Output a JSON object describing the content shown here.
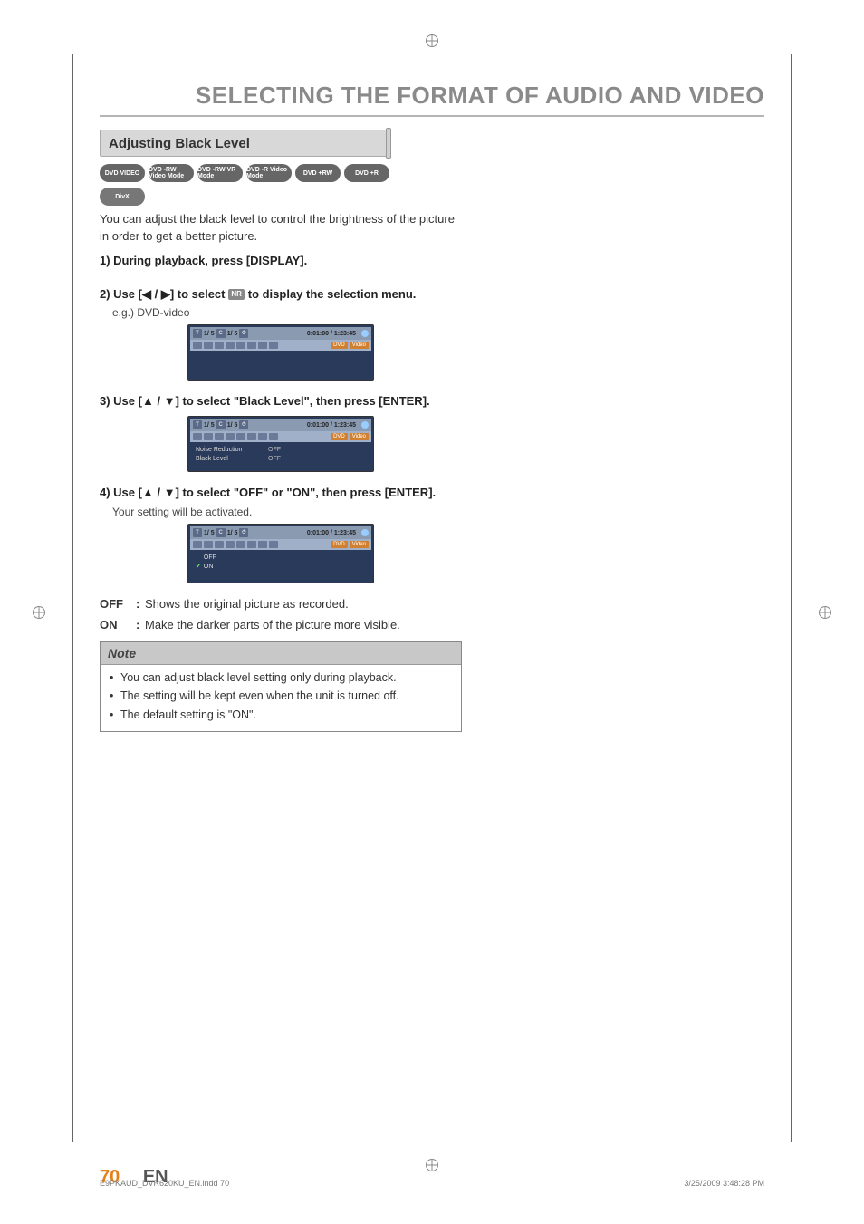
{
  "page": {
    "title": "SELECTING THE FORMAT OF AUDIO AND VIDEO",
    "number": "70",
    "lang": "EN"
  },
  "section": {
    "title": "Adjusting Black Level"
  },
  "media_badges": [
    "DVD VIDEO",
    "DVD -RW Video Mode",
    "DVD -RW VR Mode",
    "DVD -R Video Mode",
    "DVD +RW",
    "DVD +R",
    "DivX"
  ],
  "intro": "You can adjust the black level to control the brightness of the picture in order to get a better picture.",
  "steps": {
    "s1": "1) During playback, press [DISPLAY].",
    "s2_a": "2) Use [",
    "s2_b": "] to select ",
    "s2_nr": "NR",
    "s2_c": " to display the selection menu.",
    "s2_eg": "e.g.) DVD-video",
    "s3_a": "3) Use [",
    "s3_b": "] to select \"Black Level\", then press [ENTER].",
    "s4_a": "4) Use [",
    "s4_b": "] to select \"OFF\" or \"ON\", then press [ENTER].",
    "s4_sub": "Your setting will be activated."
  },
  "arrows": {
    "left": "◀",
    "right": "▶",
    "up": "▲",
    "down": "▼",
    "sep": " / "
  },
  "osd": {
    "top_t": "T",
    "top_seg1": "1/  5",
    "top_c": "C",
    "top_seg2": "1/  5",
    "time": "0:01:00 / 1:23:45",
    "tag_dvd": "DVD",
    "tag_video": "Video",
    "menu_nr_label": "Noise Reduction",
    "menu_nr_val": "OFF",
    "menu_bl_label": "Black Level",
    "menu_bl_val": "OFF",
    "sel_off": "OFF",
    "sel_on": "ON"
  },
  "defs": {
    "off_k": "OFF",
    "off_v": "Shows the original picture as recorded.",
    "on_k": "ON",
    "on_v": "Make the darker parts of the picture more visible."
  },
  "note": {
    "head": "Note",
    "items": [
      "You can adjust black level setting only during playback.",
      "The setting will be kept even when the unit is turned off.",
      "The default setting is \"ON\"."
    ]
  },
  "footer": {
    "file": "E9PKAUD_DVR620KU_EN.indd   70",
    "date": "3/25/2009   3:48:28 PM"
  }
}
